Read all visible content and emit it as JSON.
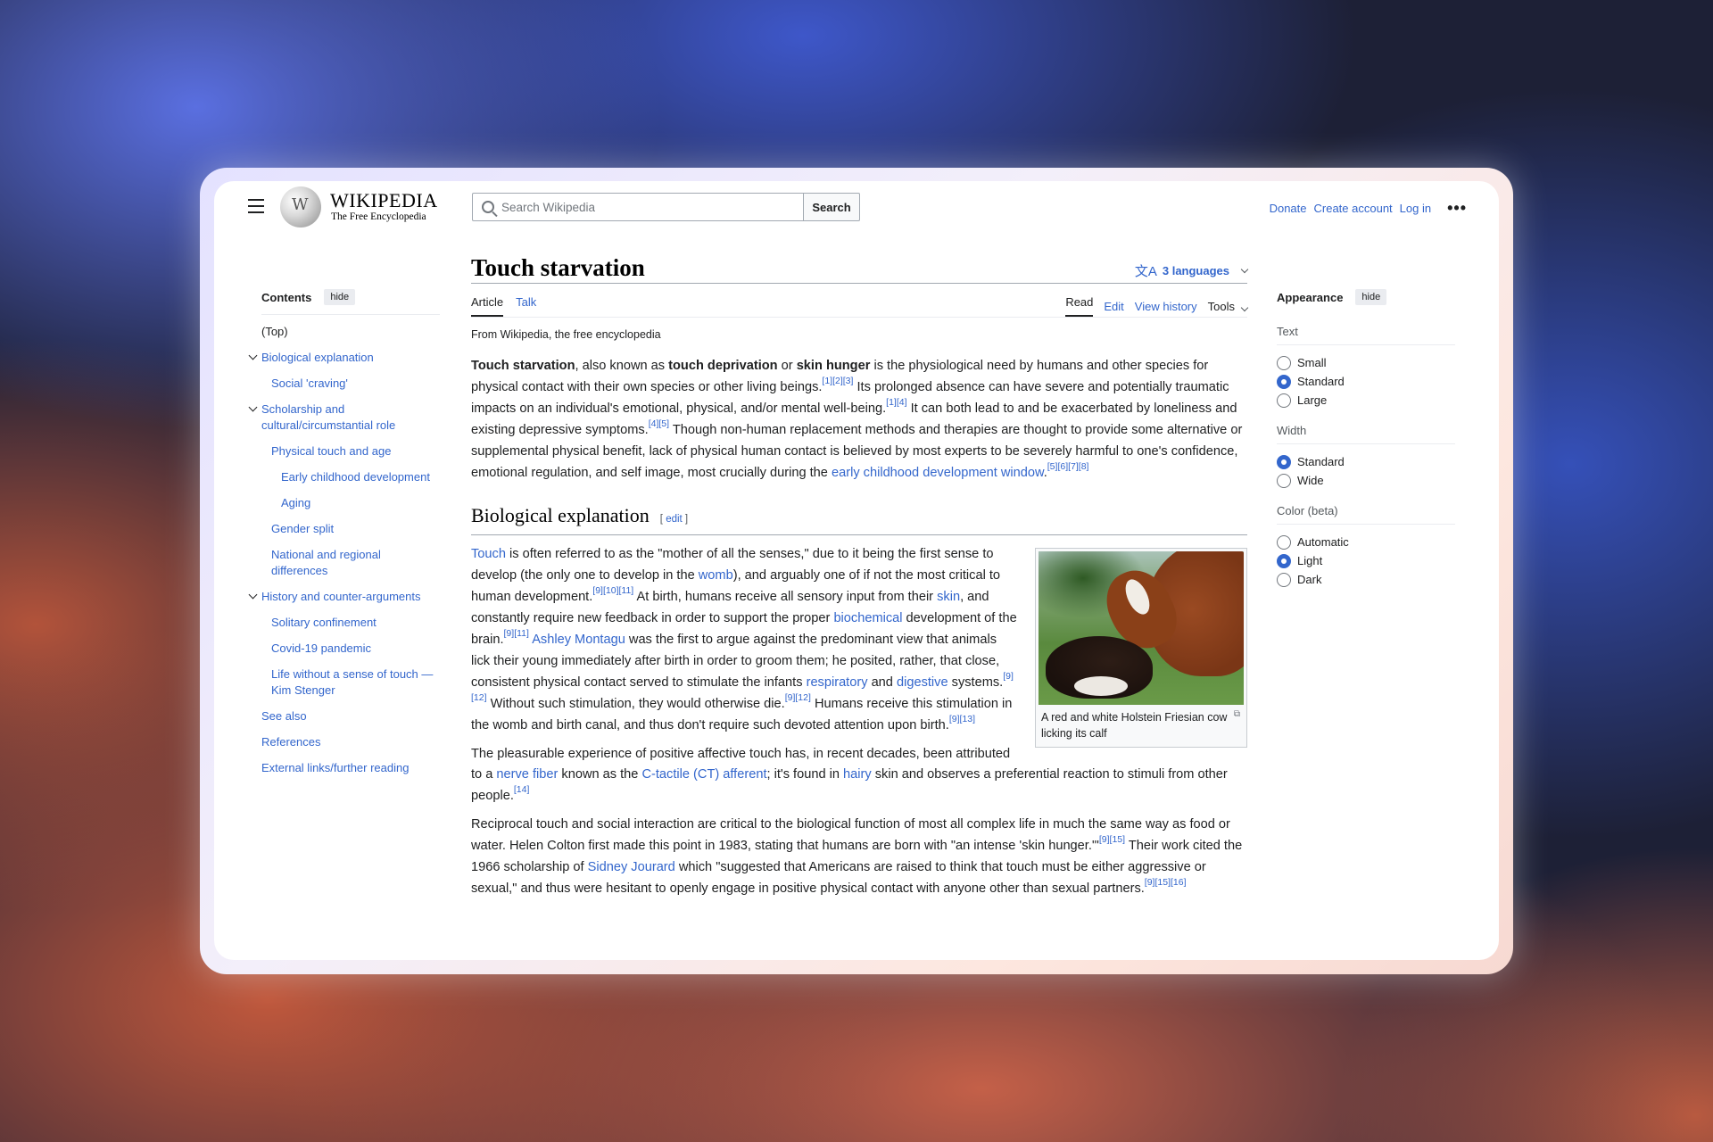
{
  "header": {
    "wordmark": "WIKIPEDIA",
    "tagline": "The Free Encyclopedia",
    "search_placeholder": "Search Wikipedia",
    "search_button": "Search",
    "donate": "Donate",
    "create_account": "Create account",
    "log_in": "Log in",
    "more": "•••"
  },
  "toc": {
    "title": "Contents",
    "hide": "hide",
    "items": [
      {
        "label": "(Top)"
      },
      {
        "label": "Biological explanation"
      },
      {
        "label": "Social 'craving'"
      },
      {
        "label": "Scholarship and cultural/circumstantial role"
      },
      {
        "label": "Physical touch and age"
      },
      {
        "label": "Early childhood development"
      },
      {
        "label": "Aging"
      },
      {
        "label": "Gender split"
      },
      {
        "label": "National and regional differences"
      },
      {
        "label": "History and counter-arguments"
      },
      {
        "label": "Solitary confinement"
      },
      {
        "label": "Covid-19 pandemic"
      },
      {
        "label": "Life without a sense of touch — Kim Stenger"
      },
      {
        "label": "See also"
      },
      {
        "label": "References"
      },
      {
        "label": "External links/further reading"
      }
    ]
  },
  "article": {
    "title": "Touch starvation",
    "languages": "3 languages",
    "tabs": {
      "article": "Article",
      "talk": "Talk",
      "read": "Read",
      "edit": "Edit",
      "history": "View history",
      "tools": "Tools"
    },
    "from": "From Wikipedia, the free encyclopedia",
    "section_title": "Biological explanation",
    "section_edit": "[ edit ]",
    "thumb_caption": "A red and white Holstein Friesian cow licking its calf"
  },
  "appearance": {
    "title": "Appearance",
    "hide": "hide",
    "text_label": "Text",
    "text_options": [
      "Small",
      "Standard",
      "Large"
    ],
    "text_selected": "Standard",
    "width_label": "Width",
    "width_options": [
      "Standard",
      "Wide"
    ],
    "width_selected": "Standard",
    "color_label": "Color (beta)",
    "color_options": [
      "Automatic",
      "Light",
      "Dark"
    ],
    "color_selected": "Light"
  },
  "colors": {
    "link": "#3366cc",
    "text": "#202122",
    "accent_radio": "#3366cc"
  }
}
